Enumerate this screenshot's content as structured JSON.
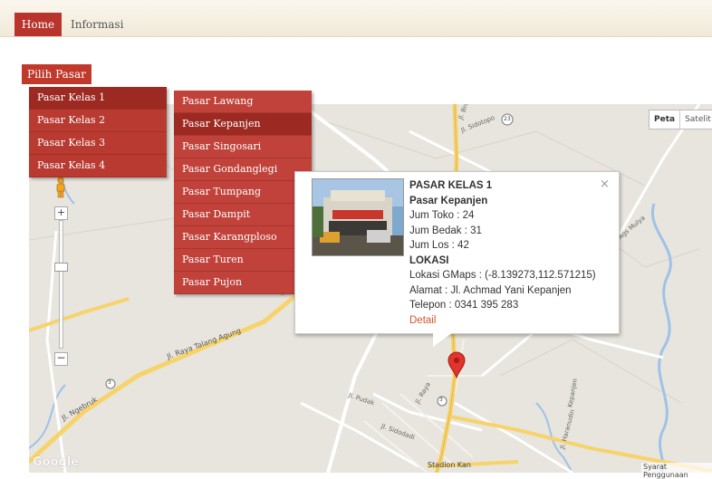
{
  "nav": {
    "home": "Home",
    "info": "Informasi"
  },
  "pilih_label": "Pilih Pasar",
  "menu_kelas": [
    {
      "label": "Pasar Kelas 1"
    },
    {
      "label": "Pasar Kelas 2"
    },
    {
      "label": "Pasar Kelas 3"
    },
    {
      "label": "Pasar Kelas 4"
    }
  ],
  "menu_pasar": [
    {
      "label": "Pasar Lawang"
    },
    {
      "label": "Pasar Kepanjen"
    },
    {
      "label": "Pasar Singosari"
    },
    {
      "label": "Pasar Gondanglegi"
    },
    {
      "label": "Pasar Tumpang"
    },
    {
      "label": "Pasar Dampit"
    },
    {
      "label": "Pasar Karangploso"
    },
    {
      "label": "Pasar Turen"
    },
    {
      "label": "Pasar Pujon"
    }
  ],
  "map_type": {
    "map": "Peta",
    "satellite": "Satelit"
  },
  "zoom": {
    "plus": "+",
    "minus": "−"
  },
  "info": {
    "kelas": "PASAR KELAS 1",
    "nama": "Pasar Kepanjen",
    "toko": "Jum Toko : 24",
    "bedak": "Jum Bedak : 31",
    "los": "Jum Los : 42",
    "lokasi_head": "LOKASI",
    "gmaps": "Lokasi GMaps : (-8.139273,112.571215)",
    "alamat": "Alamat : Jl. Achmad Yani Kepanjen",
    "telepon": "Telepon : 0341 395 283",
    "detail": "Detail",
    "close": "×"
  },
  "map_labels": {
    "raya_talang_agung": "Jl. Raya Talang Agung",
    "ngebruk": "Jl. Ngebruk",
    "sidotopo": "Jl. Sidotopo",
    "bromo": "Jl. Bromo",
    "pudak": "Jl. Pudak",
    "raya": "Jl. Raya",
    "sidodadi": "Jl. Sidodadi",
    "agus_mulya": "Jl. Ags Mulya",
    "haranudin": "Jl. Haranudin",
    "kepanjen": "Kepanjen",
    "stadion": "Stadion Kan",
    "r23": "23",
    "r3a": "3",
    "r3b": "3",
    "r3c": "3"
  },
  "google": "Google",
  "syarat": "Syarat Penggunaan",
  "colors": {
    "menu": "#b83a31",
    "active": "#9c2a22",
    "accent": "#c0392b",
    "road": "#f7d36b"
  }
}
